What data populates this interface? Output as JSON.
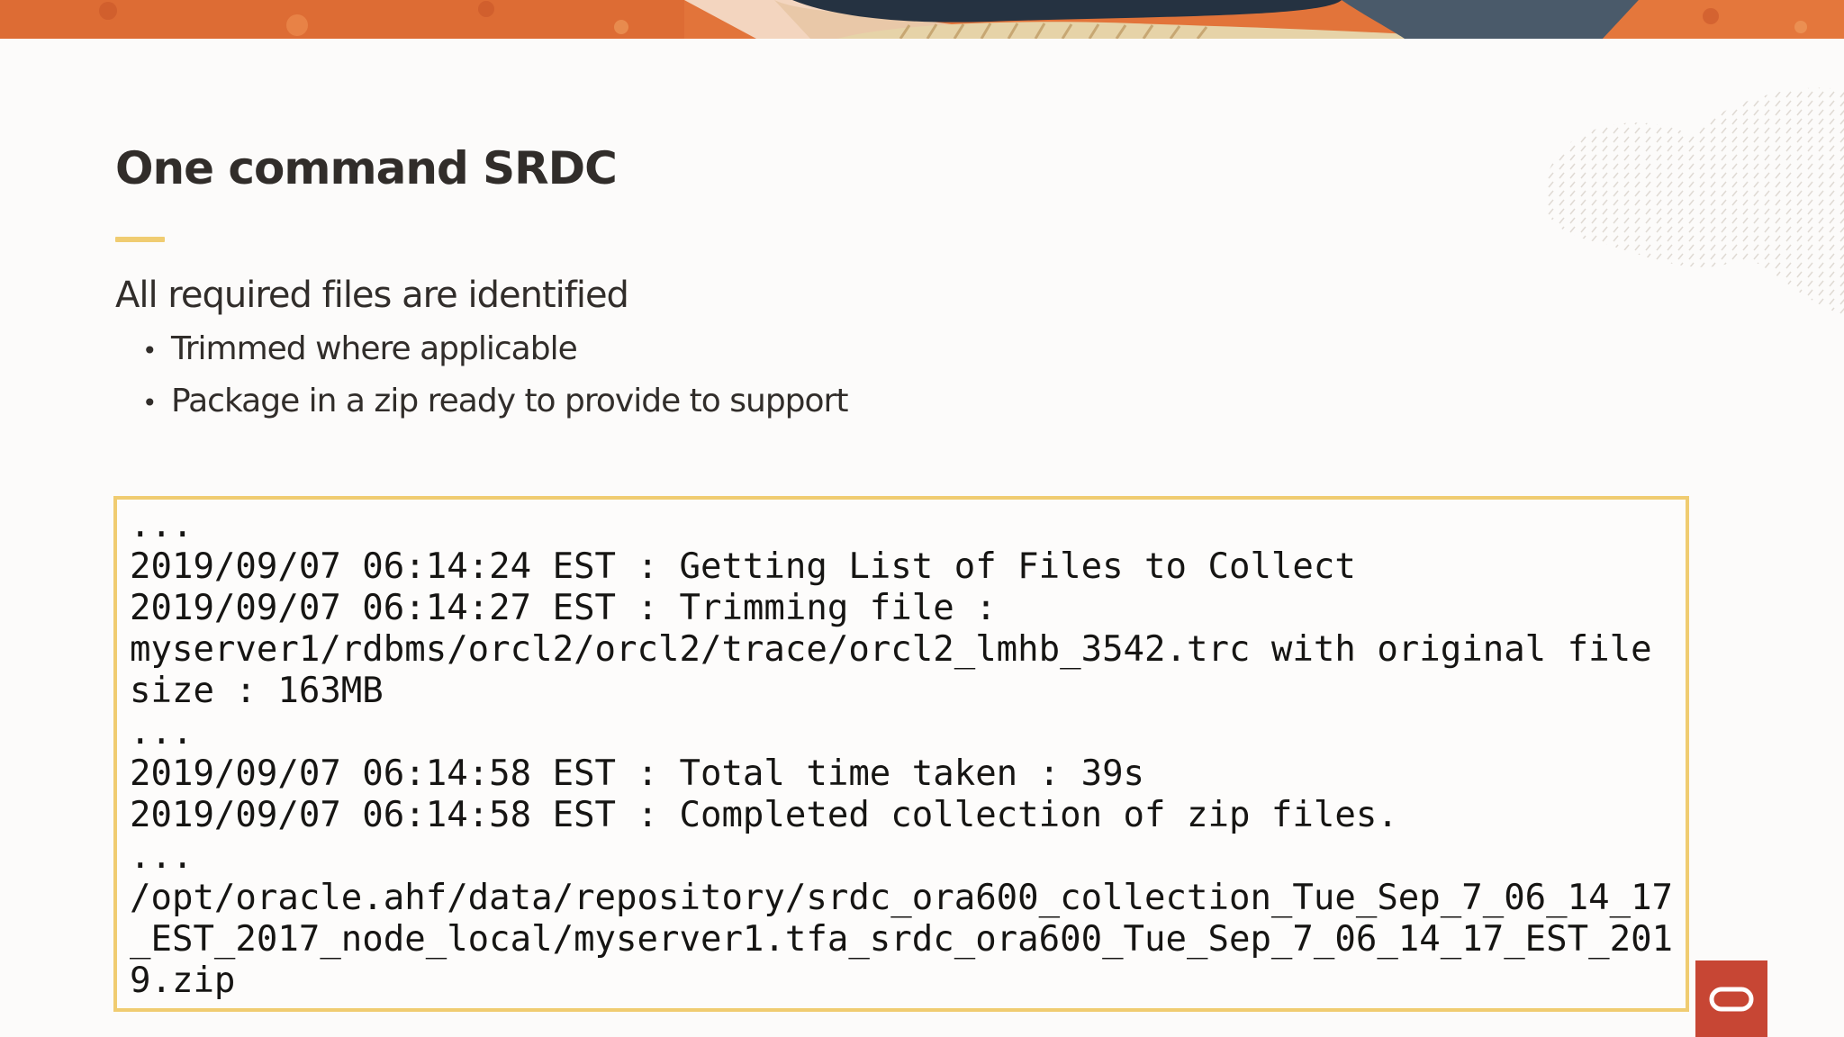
{
  "slide": {
    "title": "One command SRDC",
    "lead": "All required files are identified",
    "bullets": [
      "Trimmed where applicable",
      "Package in a zip ready to provide to support"
    ],
    "bullet_glyph": "•",
    "code_lines": [
      "...",
      "2019/09/07 06:14:24 EST : Getting List of Files to Collect",
      "2019/09/07 06:14:27 EST : Trimming file :",
      "myserver1/rdbms/orcl2/orcl2/trace/orcl2_lmhb_3542.trc with original file",
      "size : 163MB",
      "...",
      "2019/09/07 06:14:58 EST : Total time taken : 39s",
      "2019/09/07 06:14:58 EST : Completed collection of zip files.",
      "...",
      "/opt/oracle.ahf/data/repository/srdc_ora600_collection_Tue_Sep_7_06_14_17",
      "_EST_2017_node_local/myserver1.tfa_srdc_ora600_Tue_Sep_7_06_14_17_EST_201",
      "9.zip"
    ]
  },
  "icons": {
    "banner": "decorative-art-banner",
    "texture": "decorative-texture-icon",
    "logo": "oracle-logo-icon"
  },
  "colors": {
    "accent": "#f0cc71",
    "brand": "#c74634",
    "banner_orange": "#e2743a",
    "text": "#312d2a",
    "background": "#fcfbfa"
  }
}
